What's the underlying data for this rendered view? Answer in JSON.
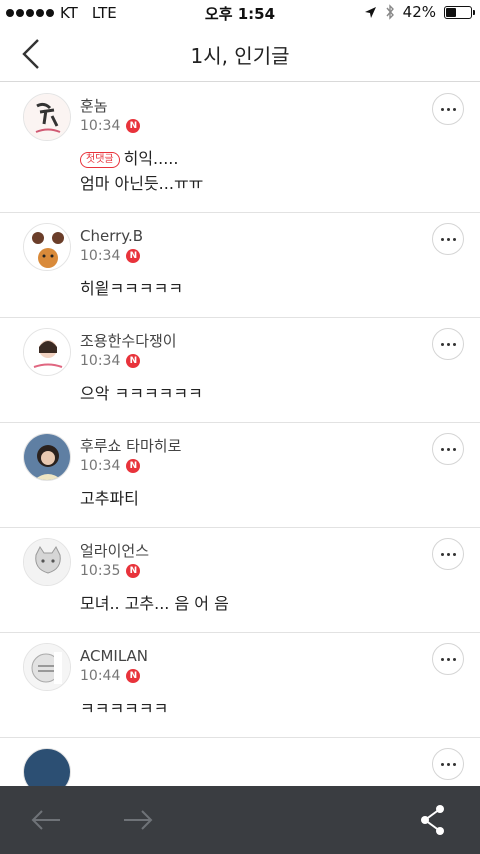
{
  "status_bar": {
    "carrier": "KT",
    "network": "LTE",
    "time": "오후 1:54",
    "battery_percent": "42%",
    "battery_level": 0.42
  },
  "header": {
    "title": "1시, 인기글"
  },
  "comments": [
    {
      "nickname": "훈놈",
      "time": "10:34",
      "badge": "N",
      "first_tag": "첫댓글",
      "lines": [
        "히익.....",
        "엄마 아닌듯...ㅠㅠ"
      ]
    },
    {
      "nickname": "Cherry.B",
      "time": "10:34",
      "badge": "N",
      "lines": [
        "히읱ㅋㅋㅋㅋㅋ"
      ]
    },
    {
      "nickname": "조용한수다쟁이",
      "time": "10:34",
      "badge": "N",
      "lines": [
        "으악 ㅋㅋㅋㅋㅋㅋ"
      ]
    },
    {
      "nickname": "후루쇼 타마히로",
      "time": "10:34",
      "badge": "N",
      "lines": [
        "고추파티"
      ]
    },
    {
      "nickname": "얼라이언스",
      "time": "10:35",
      "badge": "N",
      "lines": [
        "모녀.. 고추... 음 어 음"
      ]
    },
    {
      "nickname": "ACMILAN",
      "time": "10:44",
      "badge": "N",
      "lines": [
        "ㅋㅋㅋㅋㅋㅋ"
      ]
    }
  ],
  "icons": {
    "back": "chevron-left-icon",
    "more": "more-horizontal-icon",
    "prev": "arrow-left-icon",
    "next": "arrow-right-icon",
    "share": "share-icon",
    "location": "location-arrow-icon",
    "bluetooth": "bluetooth-icon"
  },
  "colors": {
    "accent_red": "#e8333b",
    "bottom_bar": "#3a3d41"
  }
}
